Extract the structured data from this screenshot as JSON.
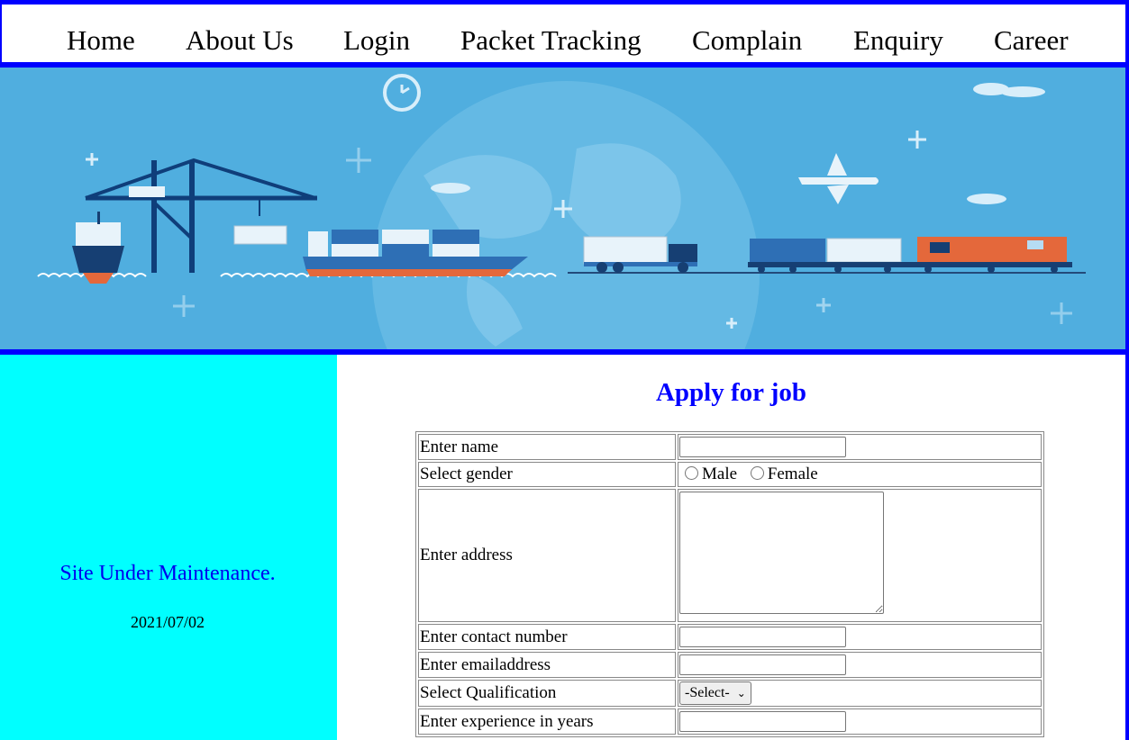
{
  "nav": {
    "items": [
      {
        "label": "Home"
      },
      {
        "label": "About Us"
      },
      {
        "label": "Login"
      },
      {
        "label": "Packet Tracking"
      },
      {
        "label": "Complain"
      },
      {
        "label": "Enquiry"
      },
      {
        "label": "Career"
      }
    ]
  },
  "banner": {
    "description_icon": "logistics-banner-image"
  },
  "sidebar": {
    "notice": "Site Under Maintenance.",
    "date": "2021/07/02"
  },
  "form": {
    "title": "Apply for job",
    "name_label": "Enter name",
    "gender_label": "Select gender",
    "gender_options": [
      "Male",
      "Female"
    ],
    "address_label": "Enter address",
    "contact_label": "Enter contact number",
    "email_label": "Enter emailaddress",
    "qualification_label": "Select Qualification",
    "qualification_selected": "-Select-",
    "experience_label": "Enter experience in years"
  },
  "colors": {
    "frame": "#0000ff",
    "sidebar_bg": "#00ffff",
    "banner_bg": "#50aedf",
    "heading": "#0000ff",
    "notice": "#0000ee"
  }
}
